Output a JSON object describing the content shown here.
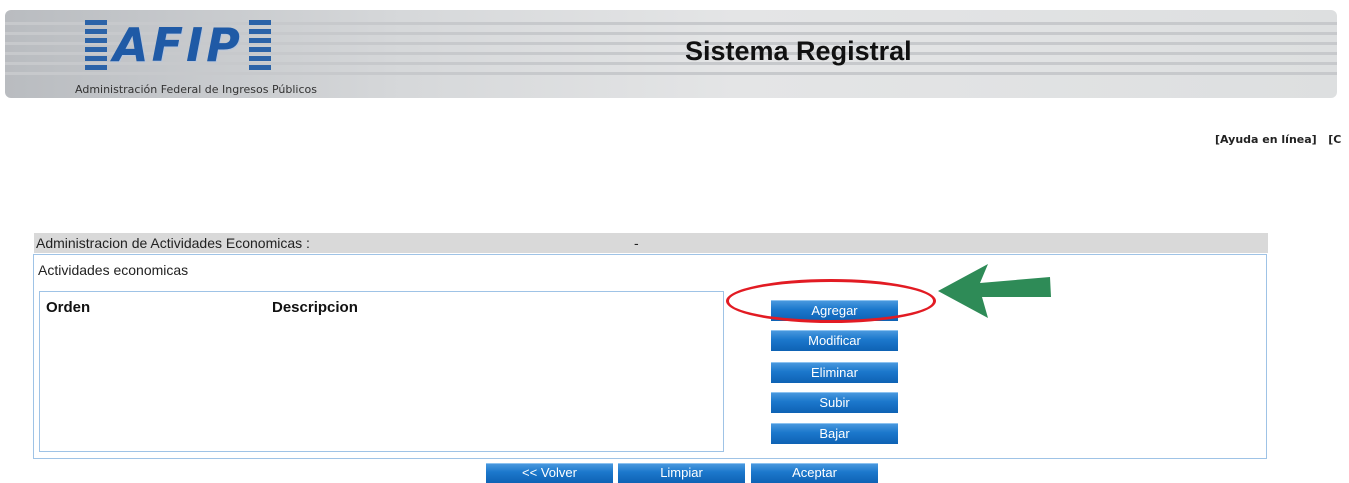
{
  "header": {
    "logo_text": "AFIP",
    "logo_subtitle": "Administración Federal de Ingresos Públicos",
    "system_title": "Sistema Registral"
  },
  "top_links": {
    "help": "[Ayuda en línea]",
    "other": "[C"
  },
  "section": {
    "title": "Administracion de Actividades Economicas :",
    "separator": "-",
    "subtitle": "Actividades economicas"
  },
  "table": {
    "columns": [
      "Orden",
      "Descripcion"
    ],
    "rows": []
  },
  "side_buttons": [
    "Agregar",
    "Modificar",
    "Eliminar",
    "Subir",
    "Bajar"
  ],
  "bottom_buttons": [
    "<< Volver",
    "Limpiar",
    "Aceptar"
  ],
  "colors": {
    "button_blue": "#1c78cc",
    "highlight_ring": "#e21b23",
    "arrow_green": "#2e8b57",
    "border_blue": "#9fc3e6"
  }
}
